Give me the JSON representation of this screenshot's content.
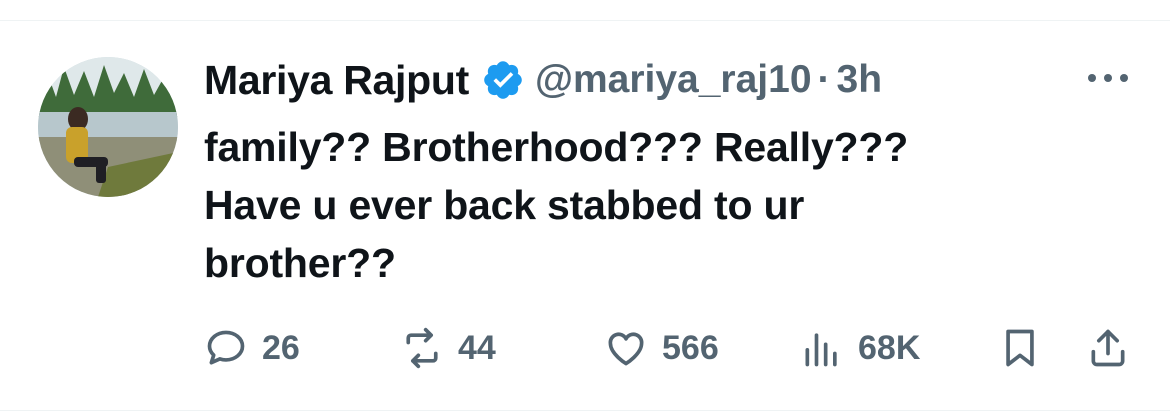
{
  "tweet": {
    "author_name": "Mariya Rajput",
    "handle": "@mariya_raj10",
    "separator": "·",
    "time": "3h",
    "verified_icon": "verified-badge-icon",
    "text_lines": [
      "family?? Brotherhood??? Really???",
      "Have u ever back stabbed to ur",
      "brother??"
    ]
  },
  "actions": {
    "replies": "26",
    "reposts": "44",
    "likes": "566",
    "views": "68K"
  },
  "colors": {
    "verified": "#1d9bf0",
    "muted": "#536471",
    "text": "#0f1419"
  }
}
